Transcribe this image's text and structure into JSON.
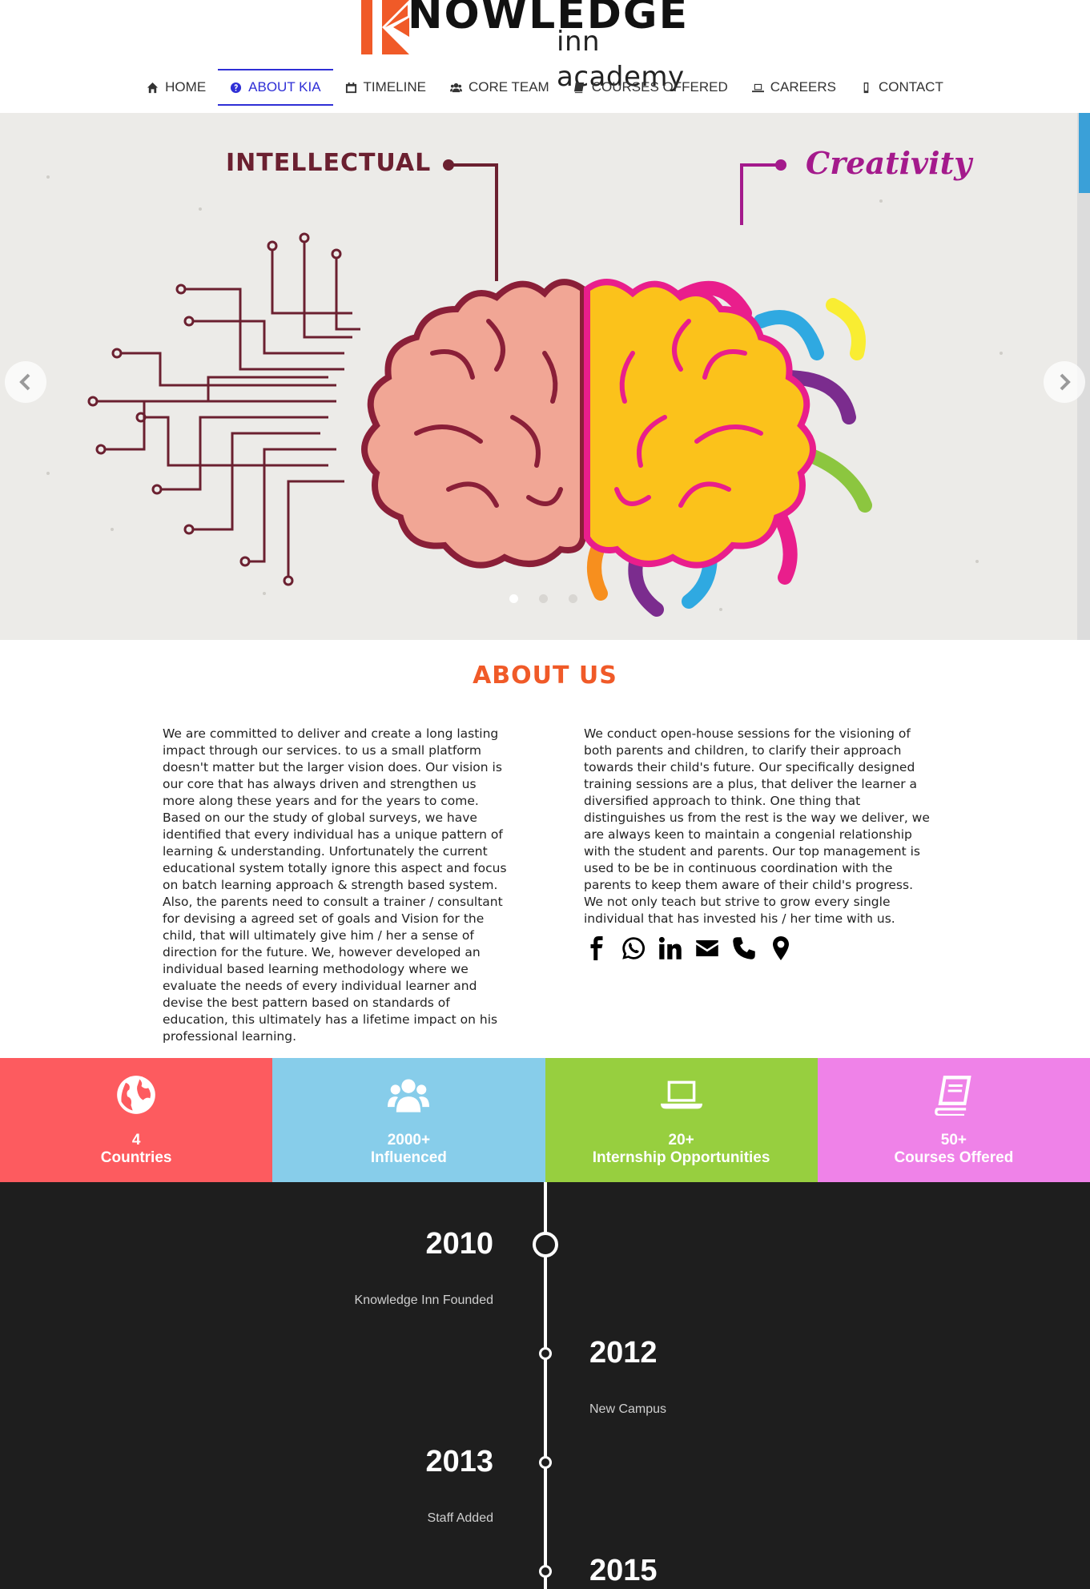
{
  "brand": {
    "word": "NOWLEDGE",
    "sub": "inn academy",
    "accent": "#f05a28"
  },
  "nav": {
    "items": [
      {
        "label": "HOME",
        "icon": "home-icon"
      },
      {
        "label": "ABOUT KIA",
        "icon": "question-circle-icon",
        "active": true
      },
      {
        "label": "TIMELINE",
        "icon": "calendar-icon"
      },
      {
        "label": "CORE TEAM",
        "icon": "users-icon"
      },
      {
        "label": "COURSES OFFERED",
        "icon": "book-icon"
      },
      {
        "label": "CAREERS",
        "icon": "laptop-icon"
      },
      {
        "label": "CONTACT",
        "icon": "mobile-icon"
      }
    ],
    "active_color": "#2f2fd6"
  },
  "hero": {
    "label_left": "INTELLECTUAL",
    "label_right": "Creativity",
    "slides": 3,
    "active_slide": 1
  },
  "about": {
    "title": "ABOUT US",
    "left_text": "We are committed to deliver and create a long lasting impact through our services. to us a small platform doesn't matter but the larger vision does. Our vision is our core that has always driven and strengthen us more along these years and for the years to come. Based on our the study of global surveys, we have identified that every individual has a unique pattern of learning & understanding. Unfortunately the current educational system totally ignore this aspect and focus on batch learning approach & strength based system. Also, the parents need to consult a trainer / consultant for devising a agreed set of goals and Vision for the child, that will ultimately give him / her a sense of direction for the future. We, however developed an individual based learning methodology where we evaluate the needs of every individual learner and devise the best pattern based on standards of education, this ultimately has a lifetime impact on his professional learning.",
    "right_text": "We conduct open-house sessions for the visioning of both parents and children, to clarify their approach towards their child's future. Our specifically designed training sessions are a plus, that deliver the learner a diversified approach to think. One thing that distinguishes us from the rest is the way we deliver, we are always keen to maintain a congenial relationship with the student and parents. Our top management is used to be be in continuous coordination with the parents to keep them aware of their child's progress. We not only teach but strive to grow every single individual that has invested his / her time with us.",
    "socials": [
      "facebook-icon",
      "whatsapp-icon",
      "linkedin-icon",
      "envelope-icon",
      "phone-icon",
      "map-marker-icon"
    ]
  },
  "stats": [
    {
      "num": "4",
      "label": "Countries",
      "color": "#fd5b5f",
      "icon": "globe-icon"
    },
    {
      "num": "2000+",
      "label": "Influenced",
      "color": "#87cdea",
      "icon": "users-icon"
    },
    {
      "num": "20+",
      "label": "Internship Opportunities",
      "color": "#97cf3f",
      "icon": "laptop-icon"
    },
    {
      "num": "50+",
      "label": "Courses Offered",
      "color": "#ef82e8",
      "icon": "book-icon"
    }
  ],
  "timeline": [
    {
      "year": "2010",
      "desc": "Knowledge Inn Founded",
      "side": "left"
    },
    {
      "year": "2012",
      "desc": "New Campus",
      "side": "right"
    },
    {
      "year": "2013",
      "desc": "Staff Added",
      "side": "left"
    },
    {
      "year": "2015",
      "desc": "",
      "side": "right"
    }
  ]
}
